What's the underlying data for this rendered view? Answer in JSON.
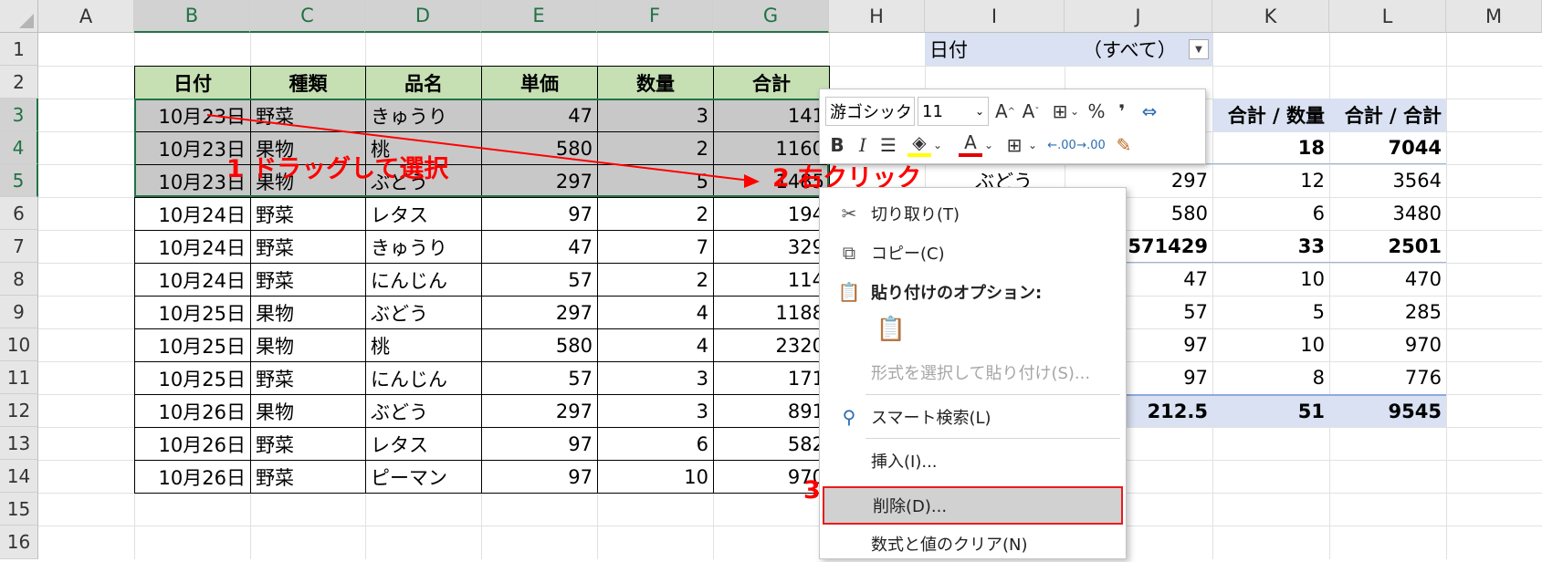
{
  "columns": [
    "A",
    "B",
    "C",
    "D",
    "E",
    "F",
    "G",
    "H",
    "I",
    "J",
    "K",
    "L",
    "M"
  ],
  "rows": [
    "1",
    "2",
    "3",
    "4",
    "5",
    "6",
    "7",
    "8",
    "9",
    "10",
    "11",
    "12",
    "13",
    "14",
    "15",
    "16"
  ],
  "table": {
    "headers": [
      "日付",
      "種類",
      "品名",
      "単価",
      "数量",
      "合計"
    ],
    "rows": [
      [
        "10月23日",
        "野菜",
        "きゅうり",
        "47",
        "3",
        "141"
      ],
      [
        "10月23日",
        "果物",
        "桃",
        "580",
        "2",
        "1160"
      ],
      [
        "10月23日",
        "果物",
        "ぶどう",
        "297",
        "5",
        "1485"
      ],
      [
        "10月24日",
        "野菜",
        "レタス",
        "97",
        "2",
        "194"
      ],
      [
        "10月24日",
        "野菜",
        "きゅうり",
        "47",
        "7",
        "329"
      ],
      [
        "10月24日",
        "野菜",
        "にんじん",
        "57",
        "2",
        "114"
      ],
      [
        "10月25日",
        "果物",
        "ぶどう",
        "297",
        "4",
        "1188"
      ],
      [
        "10月25日",
        "果物",
        "桃",
        "580",
        "4",
        "2320"
      ],
      [
        "10月25日",
        "野菜",
        "にんじん",
        "57",
        "3",
        "171"
      ],
      [
        "10月26日",
        "果物",
        "ぶどう",
        "297",
        "3",
        "891"
      ],
      [
        "10月26日",
        "野菜",
        "レタス",
        "97",
        "6",
        "582"
      ],
      [
        "10月26日",
        "野菜",
        "ピーマン",
        "97",
        "10",
        "970"
      ]
    ]
  },
  "pivot": {
    "filter_label": "日付",
    "filter_value": "（すべて）",
    "header_k": "合計 / 数量",
    "header_l": "合計 / 合計",
    "rows": [
      {
        "i": "",
        "j": "",
        "k": "18",
        "l": "7044",
        "bold": true
      },
      {
        "i": "ぶどう",
        "j": "297",
        "k": "12",
        "l": "3564",
        "bold": false
      },
      {
        "i": "",
        "j": "580",
        "k": "6",
        "l": "3480",
        "bold": false
      },
      {
        "i": "",
        "j": "8571429",
        "k": "33",
        "l": "2501",
        "bold": true
      },
      {
        "i": "",
        "j": "47",
        "k": "10",
        "l": "470",
        "bold": false
      },
      {
        "i": "",
        "j": "57",
        "k": "5",
        "l": "285",
        "bold": false
      },
      {
        "i": "",
        "j": "97",
        "k": "10",
        "l": "970",
        "bold": false
      },
      {
        "i": "",
        "j": "97",
        "k": "8",
        "l": "776",
        "bold": false
      },
      {
        "i": "",
        "j": "212.5",
        "k": "51",
        "l": "9545",
        "bold": true
      }
    ]
  },
  "annotations": {
    "step1": "1 ドラッグして選択",
    "step2": "2 右クリック",
    "step3": "3"
  },
  "toolbar": {
    "font_name": "游ゴシック",
    "font_size": "11",
    "bold": "B",
    "italic": "I",
    "percent": "%",
    "comma": "❜",
    "inc_font": "A^",
    "dec_font": "Aˇ",
    "dec_inc": ".00",
    "dec_dec": ".00"
  },
  "context_menu": {
    "cut": "切り取り(T)",
    "copy": "コピー(C)",
    "paste_options": "貼り付けのオプション:",
    "paste_special": "形式を選択して貼り付け(S)...",
    "smart_lookup": "スマート検索(L)",
    "insert": "挿入(I)...",
    "delete": "削除(D)...",
    "clear": "数式と値のクリア(N)"
  },
  "colors": {
    "header_green": "#c6e0b4",
    "selection_gray": "#c8c8c8",
    "pivot_blue": "#d9e1f2",
    "annotation_red": "#ff0000"
  }
}
